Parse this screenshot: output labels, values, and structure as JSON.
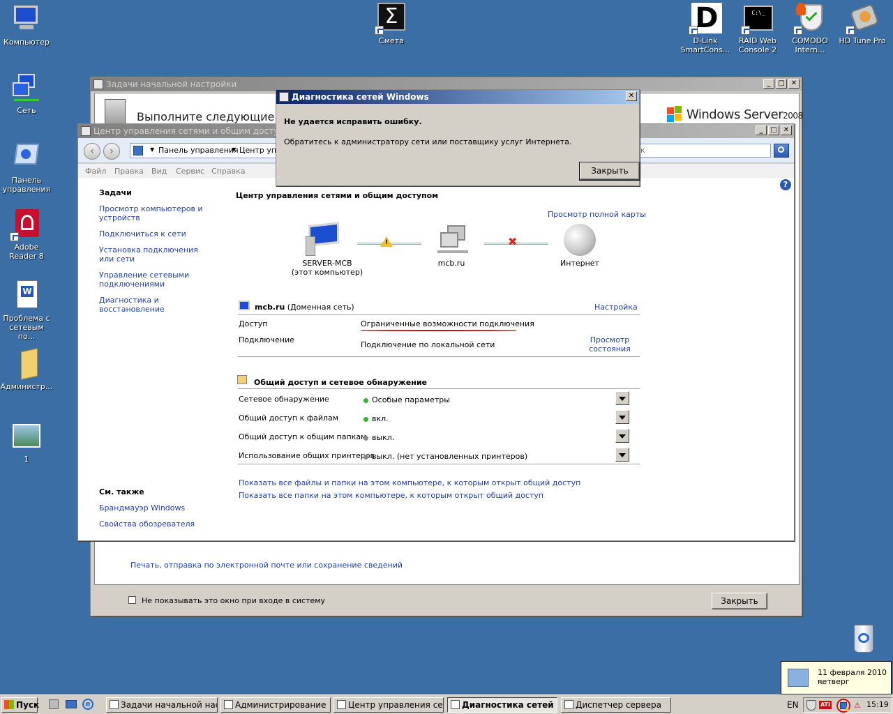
{
  "desktop": {
    "icons_left": [
      {
        "label": "Компьютер"
      },
      {
        "label": "Сеть"
      },
      {
        "label": "Панель управления"
      },
      {
        "label": "Adobe Reader 8"
      },
      {
        "label": "Проблема с сетевым по..."
      },
      {
        "label": "Администр..."
      },
      {
        "label": "1"
      }
    ],
    "icons_top": [
      {
        "label": "Смета"
      },
      {
        "label": "D-Link SmartCons..."
      },
      {
        "label": "RAID Web Console 2"
      },
      {
        "label": "COMODO Intern..."
      },
      {
        "label": "HD Tune Pro"
      }
    ],
    "recycle_bin": {
      "label": ""
    }
  },
  "init_tasks_window": {
    "title": "Задачи начальной настройки",
    "header_text": "Выполните следующие задач",
    "brand_text": "Windows Server",
    "brand_ver": "2008",
    "print_link": "Печать, отправка по электронной почте или сохранение сведений",
    "checkbox_label": "Не показывать это окно при входе в систему",
    "close_button": "Закрыть"
  },
  "network_center_window": {
    "title": "Центр управления сетями и общим доступом",
    "address": {
      "part1": "Панель управления",
      "part2": "Центр упр"
    },
    "search_placeholder": "ск",
    "menu": [
      "Файл",
      "Правка",
      "Вид",
      "Сервис",
      "Справка"
    ],
    "sidebar": {
      "tasks_heading": "Задачи",
      "tasks": [
        "Просмотр компьютеров и устройств",
        "Подключиться к сети",
        "Установка подключения или сети",
        "Управление сетевыми подключениями",
        "Диагностика и восстановление"
      ],
      "see_also_heading": "См. также",
      "see_also": [
        "Брандмауэр Windows",
        "Свойства обозревателя"
      ]
    },
    "main": {
      "heading": "Центр управления сетями и общим доступом",
      "full_map_link": "Просмотр полной карты",
      "nodes": {
        "computer_name": "SERVER-MCB",
        "computer_sub": "(этот компьютер)",
        "network_name": "mcb.ru",
        "internet_name": "Интернет"
      },
      "network": {
        "name": "mcb.ru",
        "type": "(Доменная сеть)",
        "settings_link": "Настройка",
        "access_label": "Доступ",
        "access_value": "Ограниченные возможности подключения",
        "connection_label": "Подключение",
        "connection_value": "Подключение по локальной сети",
        "view_status_link1": "Просмотр",
        "view_status_link2": "состояния"
      },
      "sharing": {
        "heading": "Общий доступ и сетевое обнаружение",
        "rows": [
          {
            "label": "Сетевое обнаружение",
            "value": "Особые параметры",
            "status_color": "#2eb82e"
          },
          {
            "label": "Общий доступ к файлам",
            "value": "вкл.",
            "status_color": "#2eb82e"
          },
          {
            "label": "Общий доступ к общим папкам",
            "value": "выкл.",
            "status_color": "#8a8a8a"
          },
          {
            "label": "Использование общих принтеров",
            "value": "выкл. (нет установленных принтеров)",
            "status_color": "#8a8a8a"
          }
        ]
      },
      "show_links": [
        "Показать все файлы и папки на этом компьютере, к которым открыт общий доступ",
        "Показать все папки на этом компьютере, к которым открыт общий доступ"
      ]
    }
  },
  "dialog": {
    "title": "Диагностика сетей Windows",
    "heading": "Не удается исправить ошибку.",
    "message": "Обратитесь к администратору сети или поставщику услуг Интернета.",
    "close_button": "Закрыть"
  },
  "tooltip": {
    "line1": "11 февраля 2010 г.",
    "line2": "четверг"
  },
  "taskbar": {
    "start": "Пуск",
    "tasks": [
      "Задачи начальной наст...",
      "Администрирование",
      "Центр управления сет...",
      "Диагностика сетей ...",
      "Диспетчер сервера"
    ],
    "lang": "EN",
    "clock": "15:19"
  }
}
